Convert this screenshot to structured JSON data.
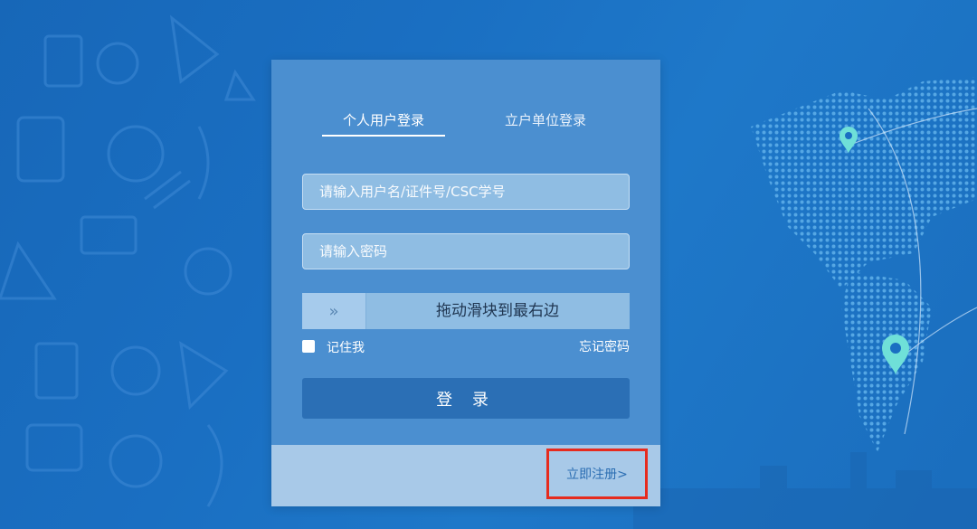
{
  "tabs": {
    "personal": "个人用户登录",
    "institution": "立户单位登录"
  },
  "form": {
    "username_placeholder": "请输入用户名/证件号/CSC学号",
    "password_placeholder": "请输入密码",
    "slider_handle": "»",
    "slider_text": "拖动滑块到最右边",
    "remember_label": "记住我",
    "forgot_password": "忘记密码",
    "login_button": "登 录"
  },
  "footer": {
    "register_link": "立即注册>"
  },
  "colors": {
    "background": "#1a6fc2",
    "card": "#4b8fd0",
    "footer": "#a8c9e8",
    "button": "#2b6fb5",
    "highlight_border": "#e62b1e"
  }
}
